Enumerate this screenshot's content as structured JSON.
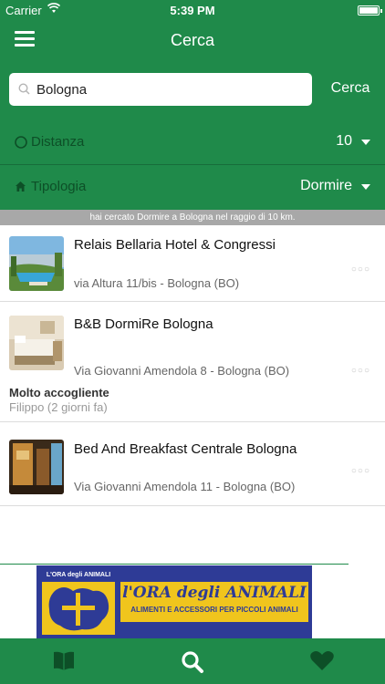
{
  "status_bar": {
    "carrier": "Carrier",
    "time": "5:39 PM",
    "wifi_icon": "wifi-icon",
    "battery_icon": "battery-icon"
  },
  "nav": {
    "title": "Cerca",
    "menu_icon": "hamburger-menu-icon"
  },
  "search": {
    "value": "Bologna",
    "button_label": "Cerca",
    "icon": "search-icon"
  },
  "filters": {
    "distance": {
      "label": "Distanza",
      "value": "10",
      "icon": "circle-icon"
    },
    "type": {
      "label": "Tipologia",
      "value": "Dormire",
      "icon": "house-icon"
    }
  },
  "info_text": "hai cercato Dormire a Bologna nel raggio di 10 km.",
  "results": [
    {
      "name": "Relais Bellaria Hotel & Congressi",
      "address": "via Altura 11/bis - Bologna (BO)"
    },
    {
      "name": "B&B DormiRe Bologna",
      "address": "Via Giovanni Amendola 8 - Bologna (BO)",
      "review_title": "Molto accogliente",
      "review_meta": "Filippo (2 giorni fa)"
    },
    {
      "name": "Bed And Breakfast Centrale Bologna",
      "address": "Via Giovanni Amendola 11 - Bologna (BO)"
    }
  ],
  "more_glyph": "○○○",
  "ad": {
    "logo_text": "L'ORA degli ANIMALI",
    "title": "l'ORA degli ANIMALI",
    "subtitle": "ALIMENTI E ACCESSORI PER PICCOLI ANIMALI"
  },
  "tabs": [
    {
      "icon": "book-icon"
    },
    {
      "icon": "search-icon"
    },
    {
      "icon": "heart-icon"
    }
  ],
  "colors": {
    "primary": "#1f8a4a",
    "primary_dark": "#0d4f27",
    "ad_blue": "#2e3b96",
    "ad_yellow": "#f0c51d"
  }
}
